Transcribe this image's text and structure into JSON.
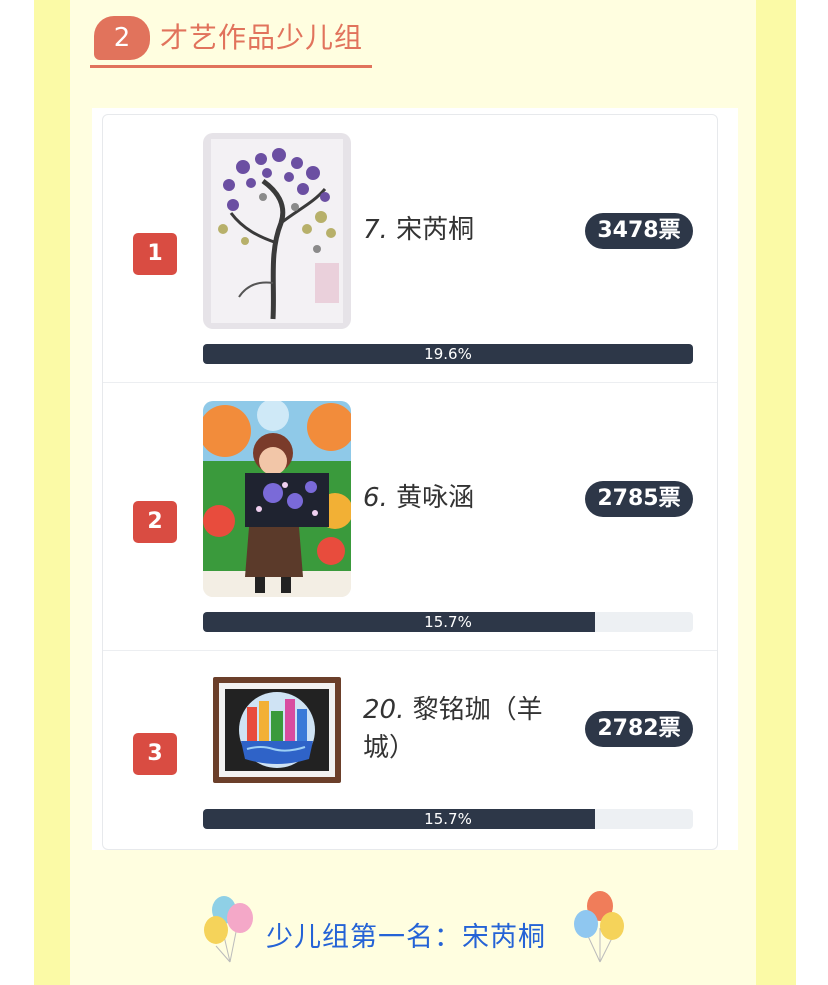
{
  "section": {
    "number": "2",
    "title": "才艺作品少儿组"
  },
  "entries": [
    {
      "rank": "1",
      "index": "7.",
      "name": "宋芮桐",
      "votes": "3478票",
      "percent_label": "19.6%",
      "bar_fill": 1.0,
      "image": "quilling-tree-artwork"
    },
    {
      "rank": "2",
      "index": "6.",
      "name": "黄咏涵",
      "votes": "2785票",
      "percent_label": "15.7%",
      "bar_fill": 0.8,
      "image": "child-holding-painting-photo"
    },
    {
      "rank": "3",
      "index": "20.",
      "name": "黎铭珈（羊城）",
      "votes": "2782票",
      "percent_label": "15.7%",
      "bar_fill": 0.8,
      "image": "framed-city-painting"
    }
  ],
  "winner": {
    "text": "少儿组第一名：宋芮桐"
  },
  "colors": {
    "accent": "#e1735c",
    "rank_badge": "#d94c42",
    "dark": "#2d3748",
    "link_blue": "#2563d6",
    "page_yellow": "#fbfaa6"
  },
  "icons": [
    "balloons-icon-left",
    "balloons-icon-right"
  ]
}
